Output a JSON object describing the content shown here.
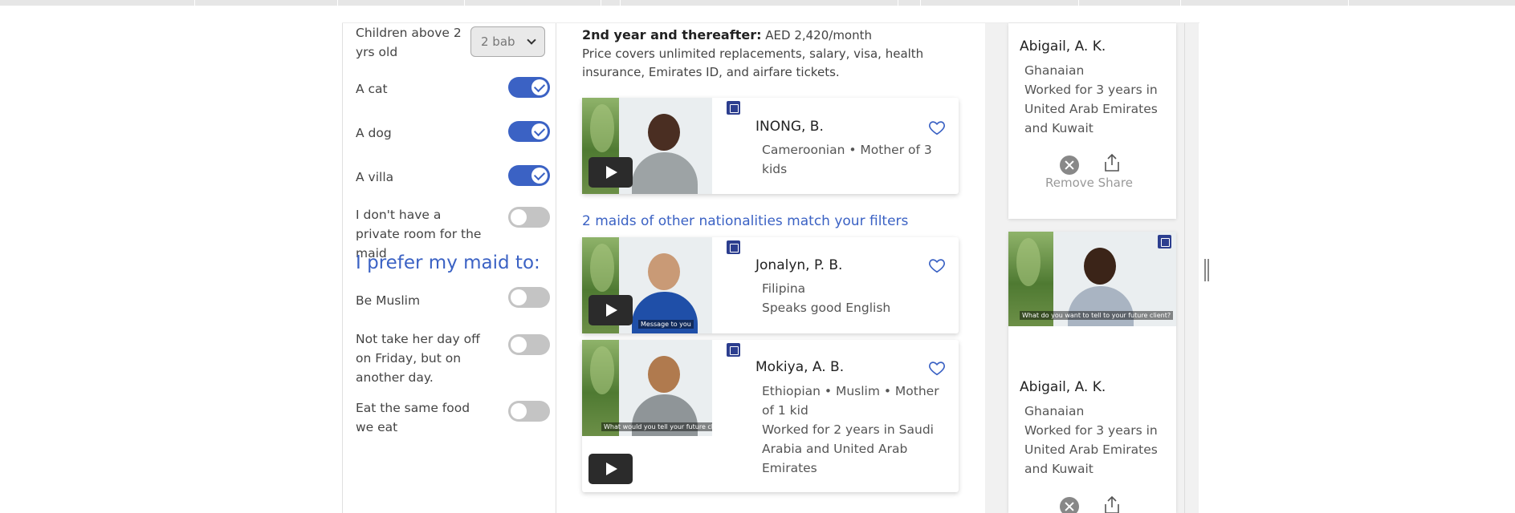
{
  "filters": {
    "children_label": "Children above 2 yrs old",
    "children_value": "2 bab",
    "items": [
      {
        "label": "A cat",
        "on": true
      },
      {
        "label": "A dog",
        "on": true
      },
      {
        "label": "A villa",
        "on": true
      },
      {
        "label": "I don't have a private room for the maid",
        "on": false
      }
    ],
    "prefer_heading": "I prefer my maid to:",
    "prefer_items": [
      {
        "label": "Be Muslim",
        "on": false
      },
      {
        "label": "Not take her day off on Friday, but on another day.",
        "on": false
      },
      {
        "label": "Eat the same food we eat",
        "on": false
      }
    ]
  },
  "pricing": {
    "year_label": "2nd year and thereafter:",
    "year_price": "AED 2,420/month",
    "note": "Price covers unlimited replacements, salary, visa, health insurance, Emirates ID, and airfare tickets."
  },
  "main_card": {
    "name": "INONG, B.",
    "desc": "Cameroonian • Mother of 3 kids"
  },
  "others_heading": "2 maids of other nationalities match your filters",
  "other_cards": [
    {
      "name": "Jonalyn, P. B.",
      "desc1": "Filipina",
      "desc2": "Speaks good English",
      "caption": "Message to you"
    },
    {
      "name": "Mokiya, A. B.",
      "desc1": "Ethiopian • Muslim • Mother of 1 kid",
      "desc2": "Worked for 2 years in Saudi Arabia and United Arab Emirates",
      "caption": "What would you tell your future client?"
    }
  ],
  "shortlist": [
    {
      "name": "Abigail, A. K.",
      "desc1": "Ghanaian",
      "desc2": "Worked for 3 years in United Arab Emirates and Kuwait",
      "remove": "Remove",
      "share": "Share"
    },
    {
      "name": "Abigail, A. K.",
      "desc1": "Ghanaian",
      "desc2": "Worked for 3 years in United Arab Emirates and Kuwait",
      "caption": "What do you want to tell to your future client?"
    }
  ],
  "colors": {
    "accent": "#3b62c4",
    "badge": "#2c3e8f"
  }
}
